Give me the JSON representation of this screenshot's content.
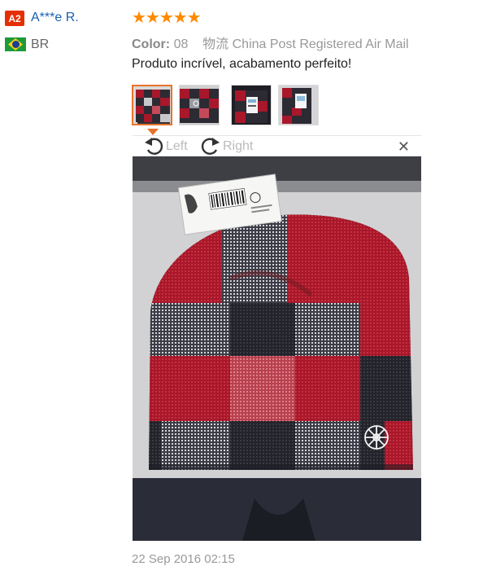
{
  "user": {
    "level_badge": "A2",
    "name": "A***e R.",
    "country_code": "BR",
    "flag_icon": "brazil-flag-icon"
  },
  "rating": {
    "stars": 5,
    "display": "★★★★★"
  },
  "order_info": {
    "color_label": "Color:",
    "color_value": "08",
    "shipping_label": "物流",
    "shipping_value": "China Post Registered Air Mail"
  },
  "review": {
    "text": "Produto incrível, acabamento perfeito!"
  },
  "photos": {
    "count": 4,
    "selected_index": 0
  },
  "viewer": {
    "rotate_left_label": "Left",
    "rotate_right_label": "Right",
    "close_icon": "close-icon"
  },
  "timestamp": "22 Sep 2016 02:15",
  "colors": {
    "badge": "#e62e04",
    "username": "#1a5fb4",
    "stars": "#ff8a00",
    "thumb_active_border": "#e8732b",
    "hat_red": "#a8172a",
    "hat_dark": "#2c2a33"
  }
}
